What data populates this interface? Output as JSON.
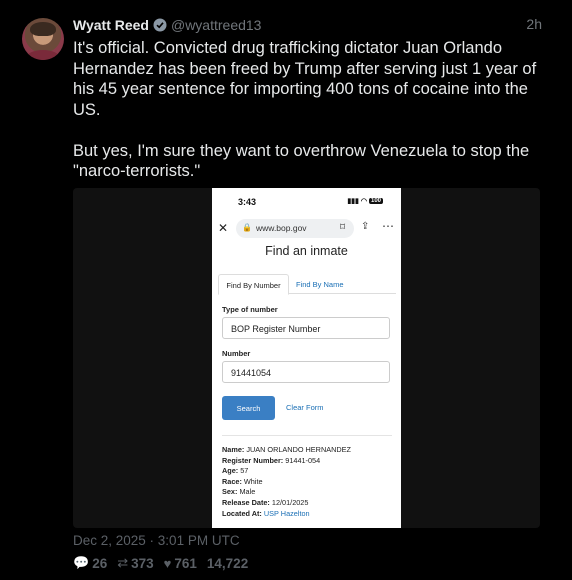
{
  "tweet": {
    "author_name": "Wyatt Reed",
    "handle": "@wyattreed13",
    "time_ago": "2h",
    "text": "It's official. Convicted drug trafficking dictator Juan Orlando Hernandez has been freed by Trump after serving just 1 year of his 45 year sentence for importing 400 tons of cocaine into the US.\n\nBut yes, I'm sure they want to overthrow Venezuela to stop the \"narco-terrorists.\"",
    "date": "Dec 2, 2025 · 3:01 PM UTC",
    "stats": {
      "replies": "26",
      "retweets": "373",
      "likes": "761",
      "views": "14,722"
    }
  },
  "screenshot": {
    "status_time": "3:43",
    "battery": "100",
    "url": "www.bop.gov",
    "page_title": "Find an inmate",
    "tabs": [
      "Find By Number",
      "Find By Name"
    ],
    "type_label": "Type of number",
    "type_value": "BOP Register Number",
    "number_label": "Number",
    "number_value": "91441054",
    "search_button": "Search",
    "clear_link": "Clear Form",
    "result": [
      {
        "label": "Name:",
        "value": "JUAN ORLANDO HERNANDEZ"
      },
      {
        "label": "Register Number:",
        "value": "91441-054"
      },
      {
        "label": "Age:",
        "value": "57"
      },
      {
        "label": "Race:",
        "value": "White"
      },
      {
        "label": "Sex:",
        "value": "Male"
      },
      {
        "label": "Release Date:",
        "value": "12/01/2025"
      },
      {
        "label": "Located At:",
        "value": "USP Hazelton"
      }
    ]
  },
  "icons": {
    "verified": "verified-badge-icon",
    "reply": "reply-icon",
    "retweet": "retweet-icon",
    "like": "heart-icon",
    "views": "views-icon"
  },
  "colors": {
    "background": "#000000",
    "text": "#e7e9ea",
    "muted": "#71767b",
    "link": "#1a6fb5",
    "button": "#3a7fc4"
  }
}
